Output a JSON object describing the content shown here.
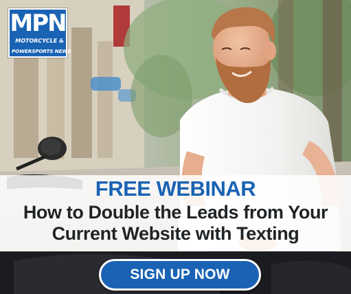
{
  "brand": {
    "logo_mark": "MPN",
    "logo_sub_line1": "MOTORCYCLE &",
    "logo_sub_line2": "POWERSPORTS NEWS",
    "color": "#1a63b4"
  },
  "ad": {
    "kicker": "FREE WEBINAR",
    "headline_line1": "How to Double the Leads from Your",
    "headline_line2": "Current Website with Texting",
    "cta_label": "SIGN UP NOW"
  }
}
